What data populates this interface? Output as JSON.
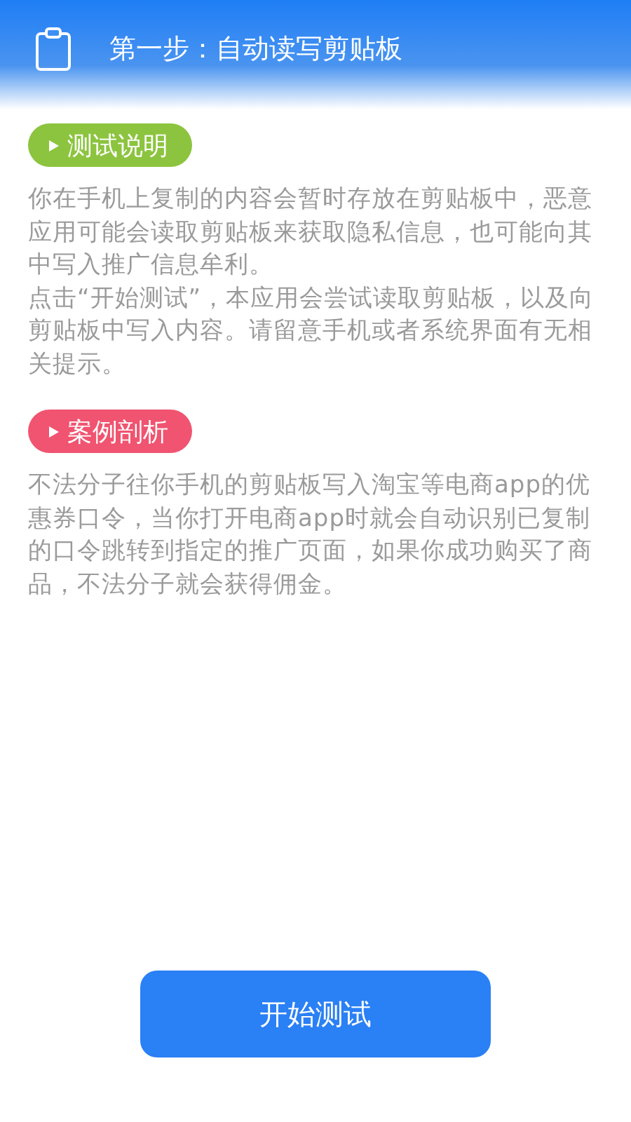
{
  "header": {
    "title": "第一步：自动读写剪贴板"
  },
  "sections": [
    {
      "tag": "测试说明",
      "color": "#8cc43f",
      "paragraphs": [
        "你在手机上复制的内容会暂时存放在剪贴板中，恶意应用可能会读取剪贴板来获取隐私信息，也可能向其中写入推广信息牟利。",
        "点击“开始测试”，本应用会尝试读取剪贴板，以及向剪贴板中写入内容。请留意手机或者系统界面有无相关提示。"
      ]
    },
    {
      "tag": "案例剖析",
      "color": "#f05470",
      "paragraphs": [
        "不法分子往你手机的剪贴板写入淘宝等电商app的优惠券口令，当你打开电商app时就会自动识别已复制的口令跳转到指定的推广页面，如果你成功购买了商品，不法分子就会获得佣金。"
      ]
    }
  ],
  "button": {
    "label": "开始测试"
  }
}
